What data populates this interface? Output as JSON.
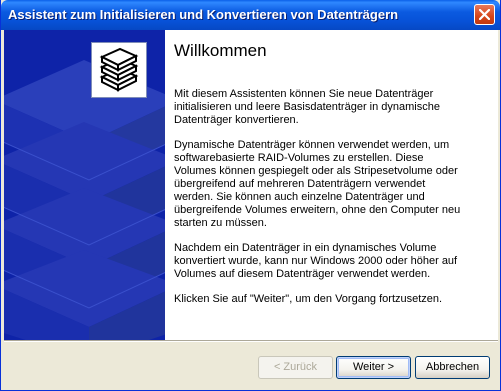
{
  "window": {
    "title": "Assistent zum Initialisieren und Konvertieren von Datenträgern"
  },
  "icons": {
    "close": "close-icon",
    "logo": "disks-stack-icon",
    "background_art": "disk-stack-graphic"
  },
  "colors": {
    "titlebar": "#0752d8",
    "left_panel": "#0e23a8",
    "dialog_background": "#ece9d8"
  },
  "main": {
    "heading": "Willkommen",
    "paragraphs": [
      "Mit diesem Assistenten können Sie neue Datenträger initialisieren und leere Basisdatenträger in dynamische Datenträger konvertieren.",
      "Dynamische Datenträger können verwendet werden, um softwarebasierte RAID-Volumes zu erstellen. Diese Volumes können gespiegelt oder als Stripesetvolume oder übergreifend auf mehreren Datenträgern verwendet werden. Sie können auch einzelne Datenträger und übergreifende Volumes erweitern, ohne den Computer neu starten zu müssen.",
      "Nachdem ein Datenträger in ein dynamisches Volume konvertiert wurde, kann nur Windows 2000 oder höher auf Volumes auf diesem Datenträger verwendet werden.",
      "Klicken Sie auf \"Weiter\", um den Vorgang fortzusetzen."
    ]
  },
  "buttons": {
    "back": "< Zurück",
    "next": "Weiter >",
    "cancel": "Abbrechen"
  }
}
